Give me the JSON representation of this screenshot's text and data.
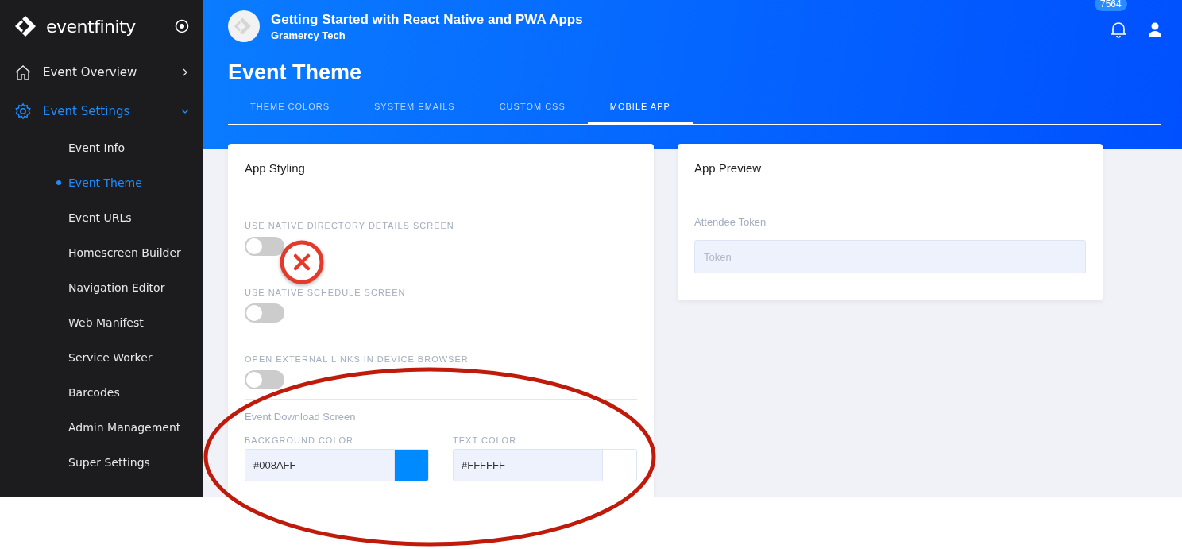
{
  "brand": {
    "name": "eventfinity"
  },
  "sidebar": {
    "items": [
      {
        "label": "Event Overview",
        "kind": "overview",
        "selected": false,
        "expanded": false
      },
      {
        "label": "Event Settings",
        "kind": "settings",
        "selected": true,
        "expanded": true,
        "children": [
          {
            "label": "Event Info",
            "selected": false
          },
          {
            "label": "Event Theme",
            "selected": true
          },
          {
            "label": "Event URLs",
            "selected": false
          },
          {
            "label": "Homescreen Builder",
            "selected": false
          },
          {
            "label": "Navigation Editor",
            "selected": false
          },
          {
            "label": "Web Manifest",
            "selected": false
          },
          {
            "label": "Service Worker",
            "selected": false
          },
          {
            "label": "Barcodes",
            "selected": false
          },
          {
            "label": "Admin Management",
            "selected": false
          },
          {
            "label": "Super Settings",
            "selected": false
          }
        ]
      }
    ]
  },
  "header": {
    "event_title": "Getting Started with React Native and PWA Apps",
    "organizer": "Gramercy Tech",
    "notification_count": "7564",
    "page_title": "Event Theme",
    "tabs": [
      {
        "label": "THEME COLORS",
        "selected": false
      },
      {
        "label": "SYSTEM EMAILS",
        "selected": false
      },
      {
        "label": "CUSTOM CSS",
        "selected": false
      },
      {
        "label": "MOBILE APP",
        "selected": true
      }
    ]
  },
  "app_styling": {
    "title": "App Styling",
    "toggles": [
      {
        "label": "USE NATIVE DIRECTORY DETAILS SCREEN",
        "on": false
      },
      {
        "label": "USE NATIVE SCHEDULE SCREEN",
        "on": false
      },
      {
        "label": "OPEN EXTERNAL LINKS IN DEVICE BROWSER",
        "on": false
      }
    ],
    "section": "Event Download Screen",
    "color_fields": [
      {
        "label": "BACKGROUND COLOR",
        "value": "#008AFF",
        "color": "#008aff"
      },
      {
        "label": "TEXT COLOR",
        "value": "#FFFFFF",
        "color": "#ffffff"
      }
    ]
  },
  "app_preview": {
    "title": "App Preview",
    "field_label": "Attendee Token",
    "placeholder": "Token"
  }
}
